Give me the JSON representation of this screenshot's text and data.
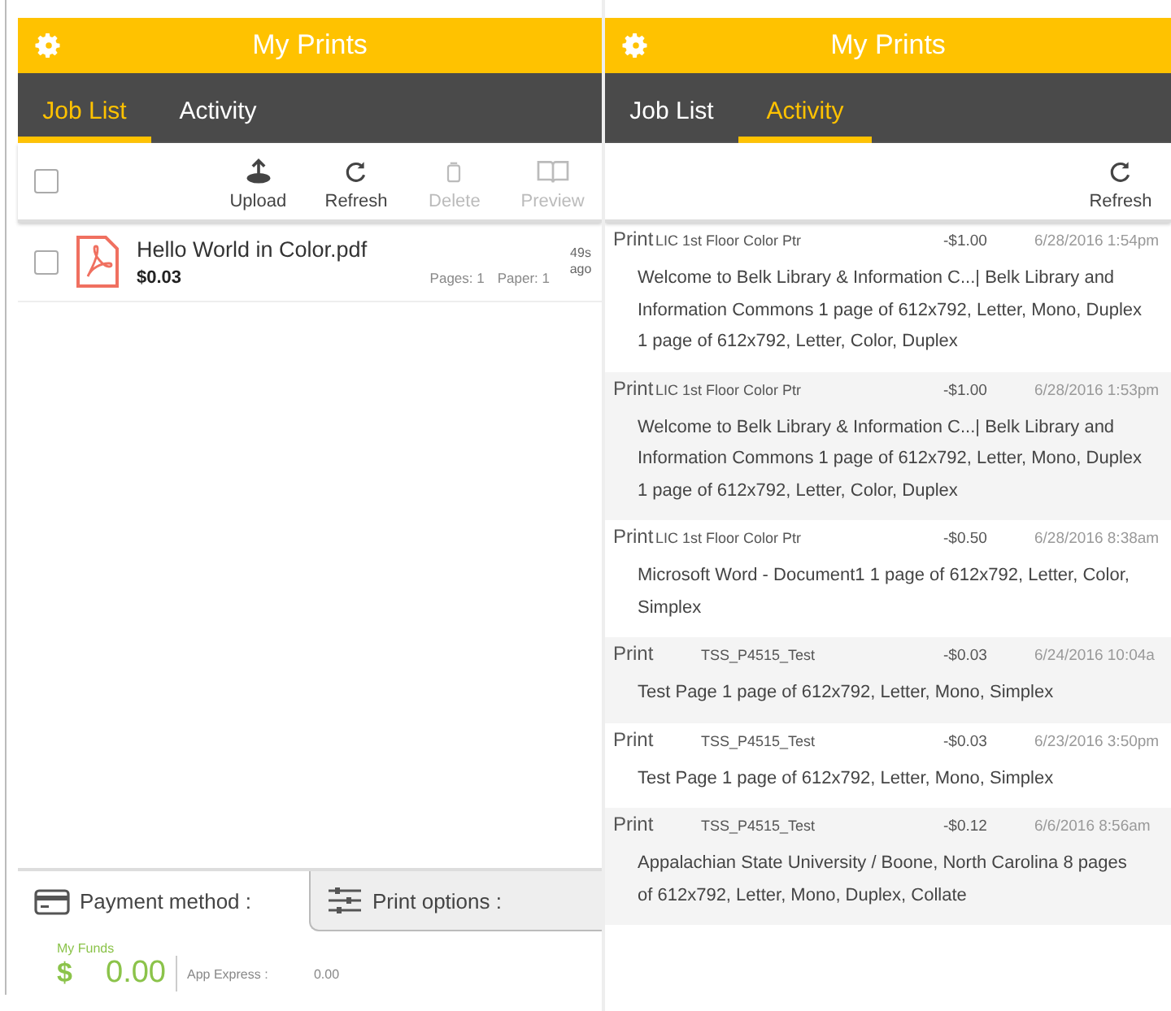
{
  "left": {
    "header": {
      "title": "My Prints"
    },
    "tabs": [
      {
        "label": "Job List",
        "selected": true
      },
      {
        "label": "Activity",
        "selected": false
      }
    ],
    "select_all": {
      "checked": false
    },
    "toolbar": [
      {
        "kind": "upload",
        "label": "Upload",
        "disabled": false
      },
      {
        "kind": "refresh",
        "label": "Refresh",
        "disabled": false
      },
      {
        "kind": "delete",
        "label": "Delete",
        "disabled": true
      },
      {
        "kind": "preview",
        "label": "Preview",
        "disabled": true
      }
    ],
    "jobs": [
      {
        "name": "Hello World in Color.pdf",
        "price": "$0.03",
        "pages": "Pages: 1",
        "paper": "Paper: 1",
        "age": "49s ago",
        "checked": false
      }
    ],
    "bottom_tabs": [
      {
        "kind": "payment",
        "label": "Payment method :",
        "selected": true
      },
      {
        "kind": "options",
        "label": "Print options :",
        "selected": false
      }
    ],
    "funds": {
      "label": "My Funds",
      "currency": "$",
      "amount": "0.00",
      "express_label": "App Express :",
      "express_value": "0.00"
    }
  },
  "right": {
    "header": {
      "title": "My Prints"
    },
    "tabs": [
      {
        "label": "Job List",
        "selected": false
      },
      {
        "label": "Activity",
        "selected": true
      }
    ],
    "toolbar": [
      {
        "kind": "refresh",
        "label": "Refresh",
        "disabled": false
      }
    ],
    "activity": [
      {
        "type": "Print",
        "printer": "LIC 1st Floor Color Ptr",
        "amount": "-$1.00",
        "date": "6/28/2016 1:54pm",
        "detail": "Welcome to Belk Library & Information C...| Belk Library and Information Commons 1 page of 612x792, Letter, Mono, Duplex 1 page of 612x792, Letter, Color, Duplex"
      },
      {
        "type": "Print",
        "printer": "LIC 1st Floor Color Ptr",
        "amount": "-$1.00",
        "date": "6/28/2016 1:53pm",
        "detail": "Welcome to Belk Library & Information C...| Belk Library and Information Commons 1 page of 612x792, Letter, Mono, Duplex 1 page of 612x792, Letter, Color, Duplex"
      },
      {
        "type": "Print",
        "printer": "LIC 1st Floor Color Ptr",
        "amount": "-$0.50",
        "date": "6/28/2016 8:38am",
        "detail": "Microsoft Word - Document1 1 page of 612x792, Letter, Color, Simplex"
      },
      {
        "type": "Print",
        "printer": "TSS_P4515_Test",
        "amount": "-$0.03",
        "date": "6/24/2016 10:04a",
        "detail": "Test Page 1 page of 612x792, Letter, Mono, Simplex"
      },
      {
        "type": "Print",
        "printer": "TSS_P4515_Test",
        "amount": "-$0.03",
        "date": "6/23/2016 3:50pm",
        "detail": "Test Page 1 page of 612x792, Letter, Mono, Simplex"
      },
      {
        "type": "Print",
        "printer": "TSS_P4515_Test",
        "amount": "-$0.12",
        "date": "6/6/2016 8:56am",
        "detail": "Appalachian State University / Boone, North Carolina 8 pages of 612x792, Letter, Mono, Duplex, Collate"
      }
    ]
  }
}
